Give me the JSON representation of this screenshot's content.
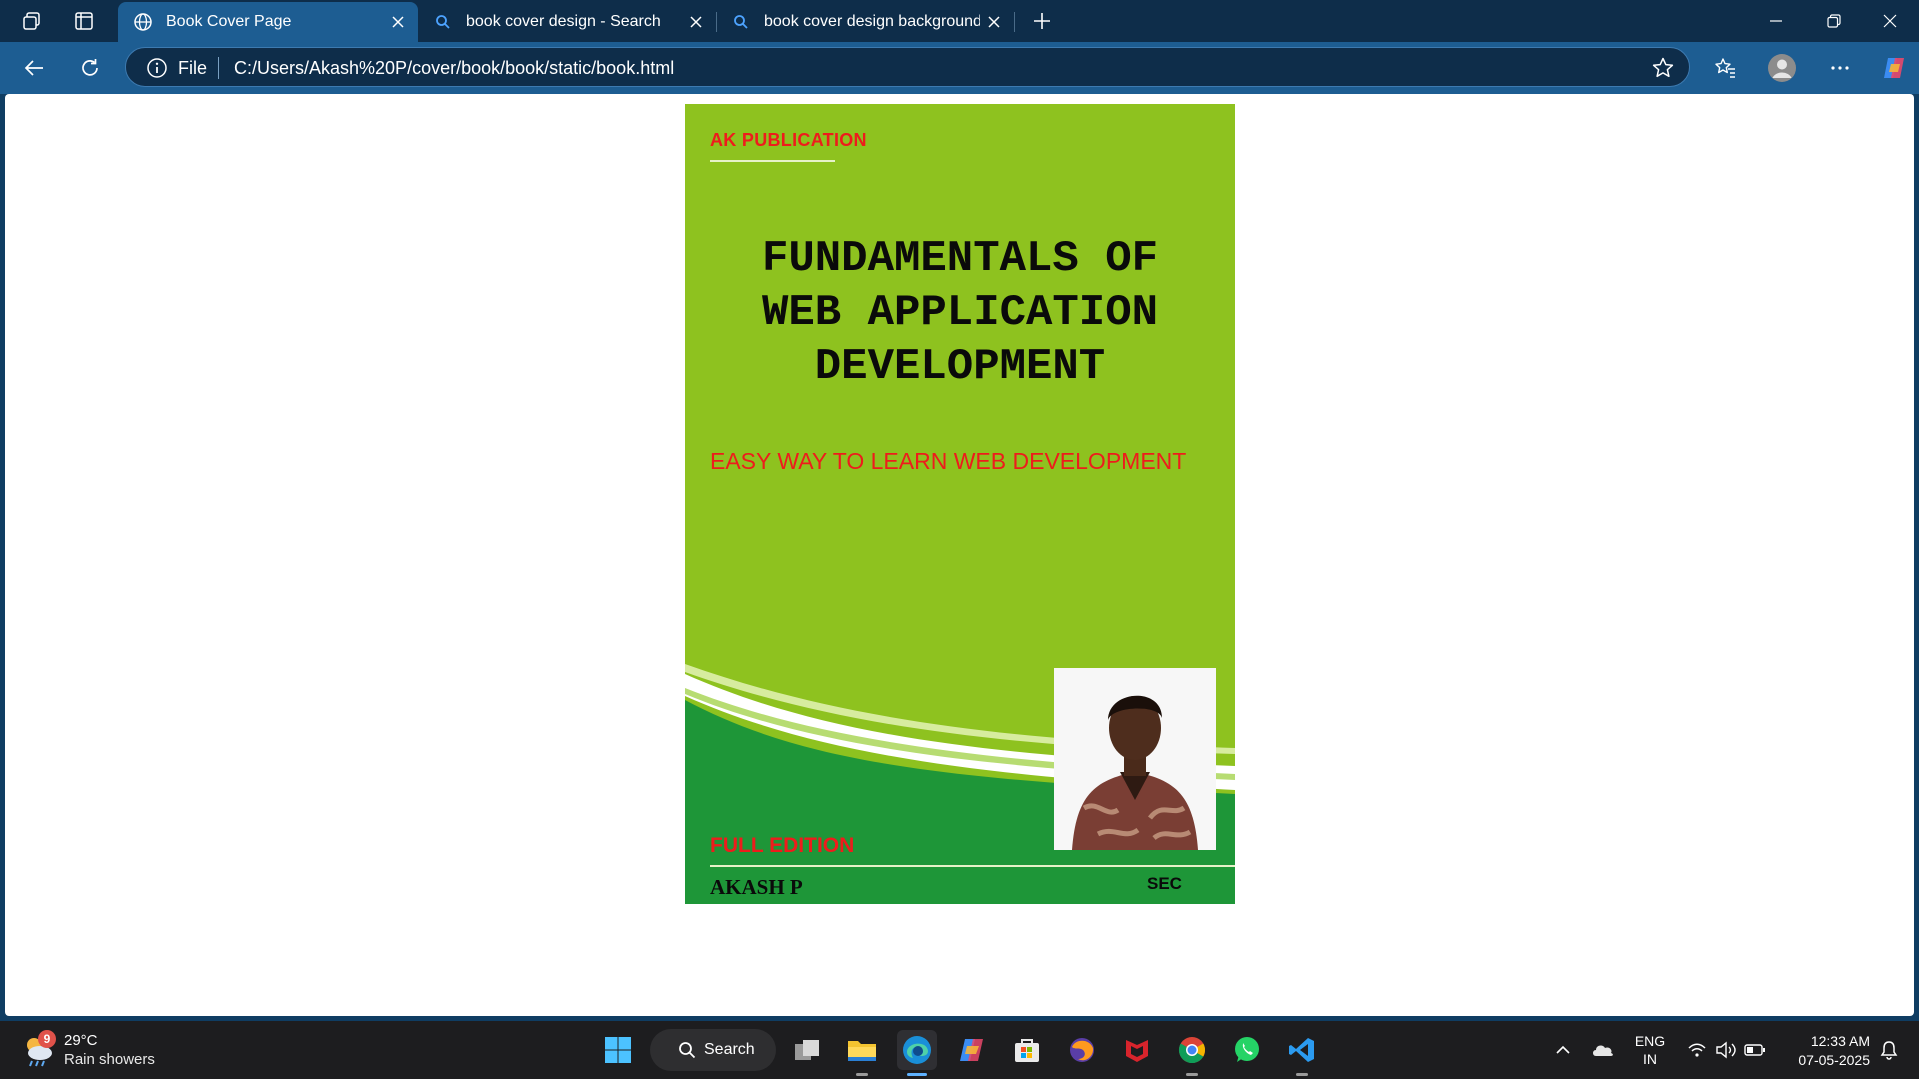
{
  "browser": {
    "tabs": [
      {
        "title": "Book Cover Page",
        "active": true,
        "icon": "globe-icon"
      },
      {
        "title": "book cover design - Search",
        "active": false,
        "icon": "search-icon"
      },
      {
        "title": "book cover design background - ",
        "active": false,
        "icon": "search-icon"
      }
    ],
    "address": {
      "scheme_label": "File",
      "url": "C:/Users/Akash%20P/cover/book/book/static/book.html"
    }
  },
  "cover": {
    "publisher": "AK PUBLICATION",
    "title_lines": [
      "FUNDAMENTALS OF",
      "WEB APPLICATION",
      "DEVELOPMENT"
    ],
    "subtitle": "EASY WAY TO LEARN WEB DEVELOPMENT",
    "edition": "FULL EDITION",
    "author": "AKASH P",
    "college": "SEC",
    "colors": {
      "background": "#8ec21f",
      "accent_red": "#ee1c1c",
      "dark_green": "#1e9638"
    }
  },
  "taskbar": {
    "weather": {
      "badge": "9",
      "temperature": "29°C",
      "condition": "Rain showers"
    },
    "search_label": "Search",
    "apps": [
      "windows-start-icon",
      "task-view-icon",
      "file-explorer-icon",
      "edge-icon",
      "copilot-icon",
      "store-icon",
      "firefox-icon",
      "mcafee-icon",
      "chrome-icon",
      "whatsapp-icon",
      "vscode-icon"
    ],
    "language": {
      "line1": "ENG",
      "line2": "IN"
    },
    "clock": {
      "time": "12:33 AM",
      "date": "07-05-2025"
    }
  }
}
